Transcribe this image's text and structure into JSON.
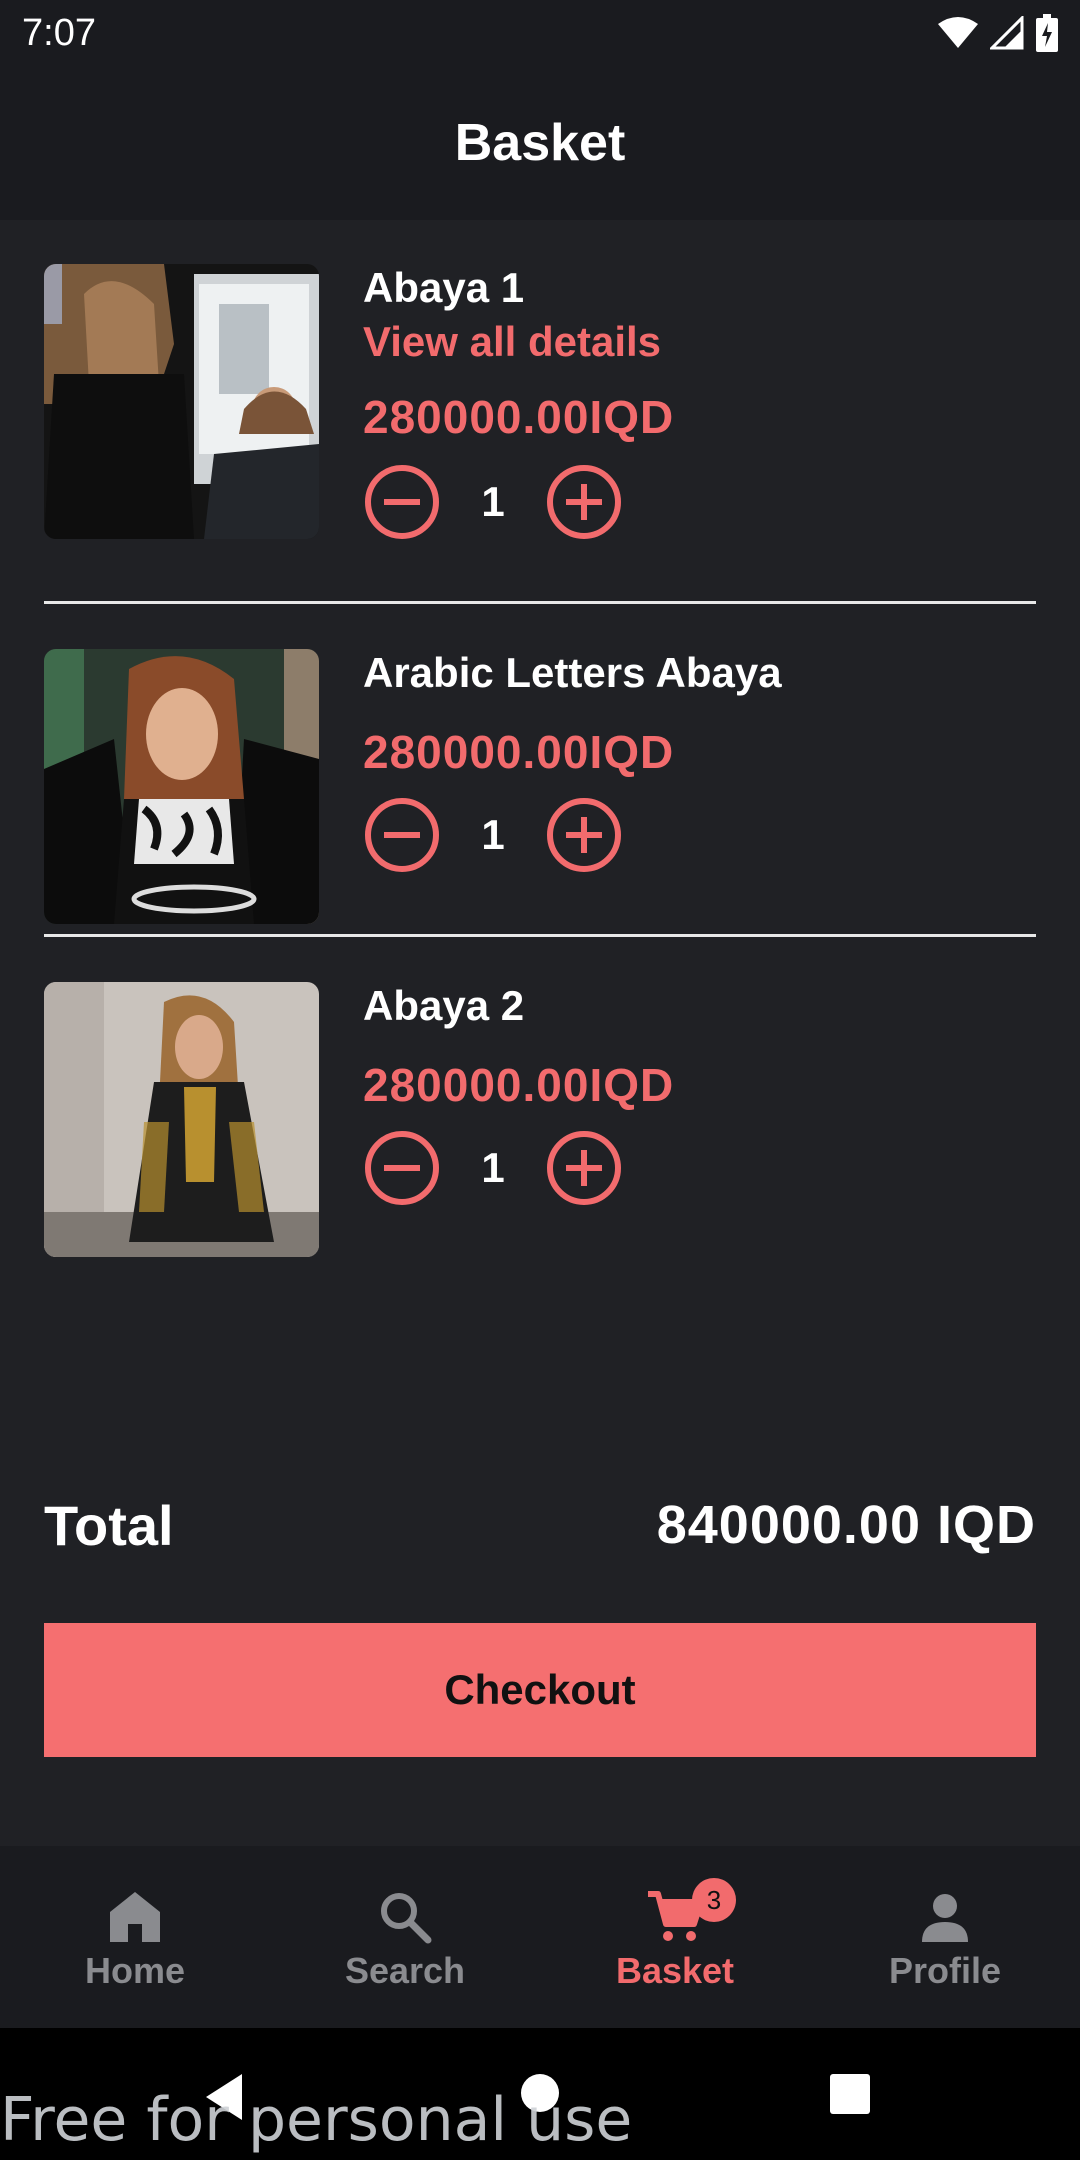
{
  "status": {
    "time": "7:07"
  },
  "app_bar": {
    "title": "Basket"
  },
  "items": [
    {
      "name": "Abaya 1",
      "link": "View all details",
      "price": "280000.00IQD",
      "qty": "1"
    },
    {
      "name": "Arabic Letters Abaya",
      "price": "280000.00IQD",
      "qty": "1"
    },
    {
      "name": "Abaya 2",
      "price": "280000.00IQD",
      "qty": "1"
    }
  ],
  "summary": {
    "total_label": "Total",
    "total_value": "840000.00 IQD"
  },
  "checkout": {
    "label": "Checkout"
  },
  "nav": {
    "items": [
      {
        "label": "Home",
        "icon": "home-icon"
      },
      {
        "label": "Search",
        "icon": "search-icon"
      },
      {
        "label": "Basket",
        "icon": "cart-icon",
        "badge": "3",
        "active": true
      },
      {
        "label": "Profile",
        "icon": "person-icon"
      }
    ]
  },
  "watermark": "Free for personal use",
  "colors": {
    "accent": "#f26b6d",
    "background": "#202125",
    "bar": "#1a1b1f",
    "checkout": "#f56f70"
  }
}
